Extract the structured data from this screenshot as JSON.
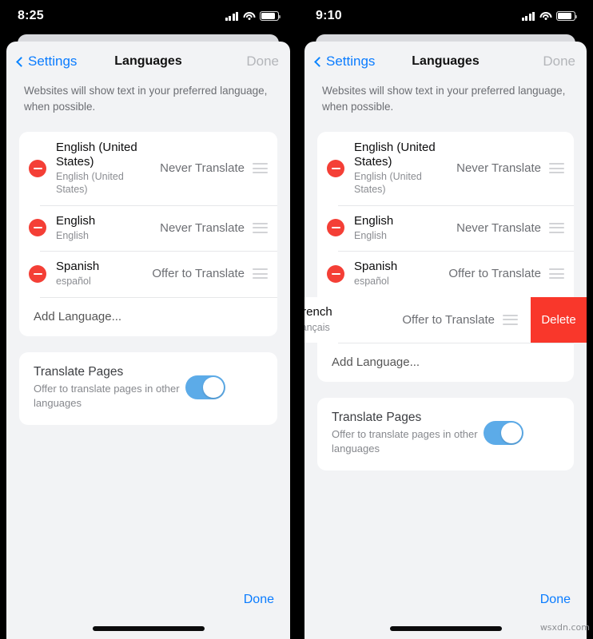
{
  "watermark": "wsxdn.com",
  "panels": [
    {
      "status": {
        "time": "8:25",
        "signal_icon": "cellular-signal-icon",
        "wifi_icon": "wifi-icon",
        "battery_icon": "battery-icon"
      },
      "nav": {
        "back_label": "Settings",
        "title": "Languages",
        "done_label": "Done"
      },
      "description": "Websites will show text in your preferred language, when possible.",
      "languages": [
        {
          "primary": "English (United States)",
          "secondary": "English (United States)",
          "action": "Never Translate"
        },
        {
          "primary": "English",
          "secondary": "English",
          "action": "Never Translate"
        },
        {
          "primary": "Spanish",
          "secondary": "español",
          "action": "Offer to Translate"
        }
      ],
      "add_language_label": "Add Language...",
      "translate_pages": {
        "title": "Translate Pages",
        "subtitle": "Offer to translate pages in other languages",
        "toggle_state": "on"
      },
      "bottom_done_label": "Done",
      "swiped_row": null
    },
    {
      "status": {
        "time": "9:10",
        "signal_icon": "cellular-signal-icon",
        "wifi_icon": "wifi-icon",
        "battery_icon": "battery-icon"
      },
      "nav": {
        "back_label": "Settings",
        "title": "Languages",
        "done_label": "Done"
      },
      "description": "Websites will show text in your preferred language, when possible.",
      "languages": [
        {
          "primary": "English (United States)",
          "secondary": "English (United States)",
          "action": "Never Translate"
        },
        {
          "primary": "English",
          "secondary": "English",
          "action": "Never Translate"
        },
        {
          "primary": "Spanish",
          "secondary": "español",
          "action": "Offer to Translate"
        }
      ],
      "swiped_row": {
        "primary": "French",
        "secondary": "français",
        "action": "Offer to Translate",
        "delete_label": "Delete"
      },
      "add_language_label": "Add Language...",
      "translate_pages": {
        "title": "Translate Pages",
        "subtitle": "Offer to translate pages in other languages",
        "toggle_state": "on"
      },
      "bottom_done_label": "Done"
    }
  ],
  "colors": {
    "accent_blue": "#0a7cff",
    "destructive_red": "#f9372b",
    "minus_red": "#f43f36",
    "toggle_on": "#5cabe8",
    "sheet_bg": "#f2f3f5",
    "card_bg": "#ffffff"
  }
}
